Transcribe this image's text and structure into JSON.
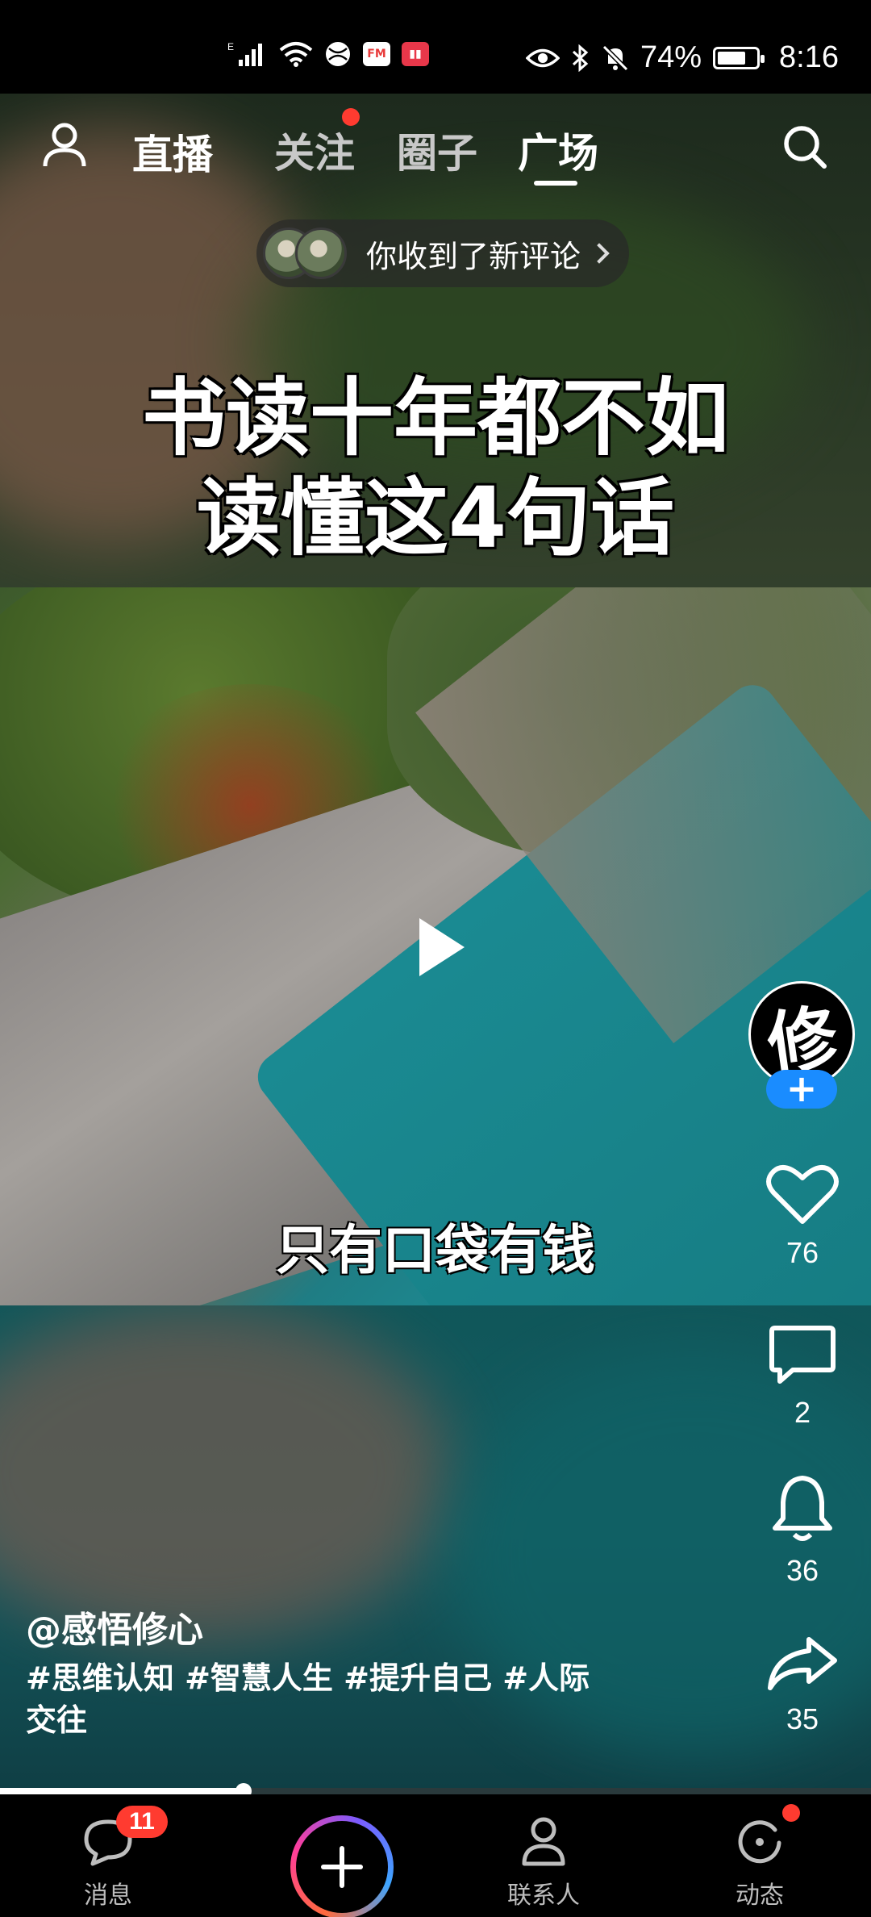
{
  "status_bar": {
    "battery_percent": "74%",
    "time": "8:16",
    "battery_level": 0.74
  },
  "top_nav": {
    "live_label": "直播",
    "tabs": [
      {
        "label": "关注"
      },
      {
        "label": "圈子"
      },
      {
        "label": "广场"
      }
    ]
  },
  "notification": {
    "text": "你收到了新评论"
  },
  "video": {
    "title_line1": "书读十年都不如",
    "title_line2": "读懂这4句话",
    "subtitle": "只有口袋有钱"
  },
  "author": {
    "avatar_char": "修",
    "name": "@感悟修心",
    "follow_label": "+"
  },
  "caption": {
    "hashtags": "#思维认知 #智慧人生 #提升自己 #人际交往"
  },
  "actions": {
    "likes": "76",
    "comments": "2",
    "reminders": "36",
    "shares": "35"
  },
  "progress": {
    "fraction": 0.28
  },
  "bottom_nav": {
    "messages_label": "消息",
    "messages_badge": "11",
    "contacts_label": "联系人",
    "dynamic_label": "动态"
  },
  "colors": {
    "accent_red": "#ff3b30",
    "follow_blue": "#1a8cff"
  }
}
